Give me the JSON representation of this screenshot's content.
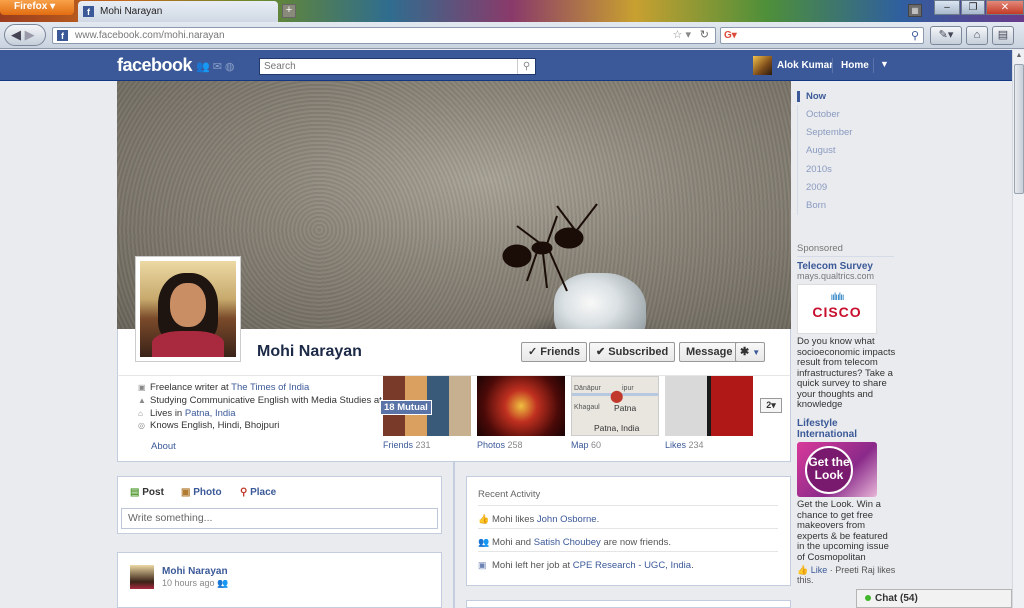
{
  "browser": {
    "firefox_label": "Firefox",
    "tab_title": "Mohi Narayan",
    "url_host": "www.facebook.com/",
    "url_path": "mohi.narayan",
    "colors": {
      "firefox_button": "#e36d10",
      "chrome": "#c9d3df"
    }
  },
  "fb": {
    "logo": "facebook",
    "search_placeholder": "Search",
    "user_name": "Alok Kumar",
    "home_label": "Home",
    "brand_color": "#3b5998"
  },
  "profile": {
    "name": "Mohi Narayan",
    "friends_button": "Friends",
    "subscribed_button": "Subscribed",
    "message_button": "Message",
    "settings_icon": "gear-icon",
    "info": {
      "work_prefix": "Freelance writer at ",
      "work_link": "The Times of India",
      "study": "Studying Communicative English with Media Studies at ...",
      "lives_prefix": "Lives in ",
      "lives_link": "Patna, India",
      "languages": "Knows English, Hindi, Bhojpuri"
    },
    "about_label": "About",
    "tiles": [
      {
        "label": "Friends",
        "count": "231",
        "overlay": "18 Mutual"
      },
      {
        "label": "Photos",
        "count": "258"
      },
      {
        "label": "Map",
        "count": "60",
        "map_text": "Patna, India",
        "map_places": [
          "Dānāpur",
          "Khagaul",
          "Patna",
          "ipur"
        ]
      },
      {
        "label": "Likes",
        "count": "234"
      }
    ],
    "more_button": "2"
  },
  "composer": {
    "tabs": [
      "Post",
      "Photo",
      "Place"
    ],
    "placeholder": "Write something..."
  },
  "story": {
    "author": "Mohi Narayan",
    "time": "10 hours ago"
  },
  "recent": {
    "title": "Recent Activity",
    "items": [
      {
        "prefix": "Mohi likes ",
        "link": "John Osborne",
        "suffix": "."
      },
      {
        "prefix": "Mohi and ",
        "link": "Satish Choubey",
        "suffix": " are now friends."
      },
      {
        "prefix": "Mohi left her job at ",
        "link": "CPE Research - UGC, India",
        "suffix": "."
      }
    ]
  },
  "timeline_nav": [
    "Now",
    "October",
    "September",
    "August",
    "2010s",
    "2009",
    "Born"
  ],
  "ads": {
    "sponsored": "Sponsored",
    "ad1": {
      "title": "Telecom Survey",
      "domain": "mays.qualtrics.com",
      "image_text": "CISCO",
      "text": "Do you know what socioeconomic impacts result from telecom infrastructures? Take a quick survey to share your thoughts and knowledge"
    },
    "ad2": {
      "title": "Lifestyle International",
      "image_text": "Get the Look",
      "text": "Get the Look. Win a chance to get free makeovers from experts & be featured in the upcoming issue of Cosmopolitan",
      "like": "Like",
      "like_by": " · Preeti Raj likes this."
    }
  },
  "chat": {
    "label": "Chat (54)"
  }
}
